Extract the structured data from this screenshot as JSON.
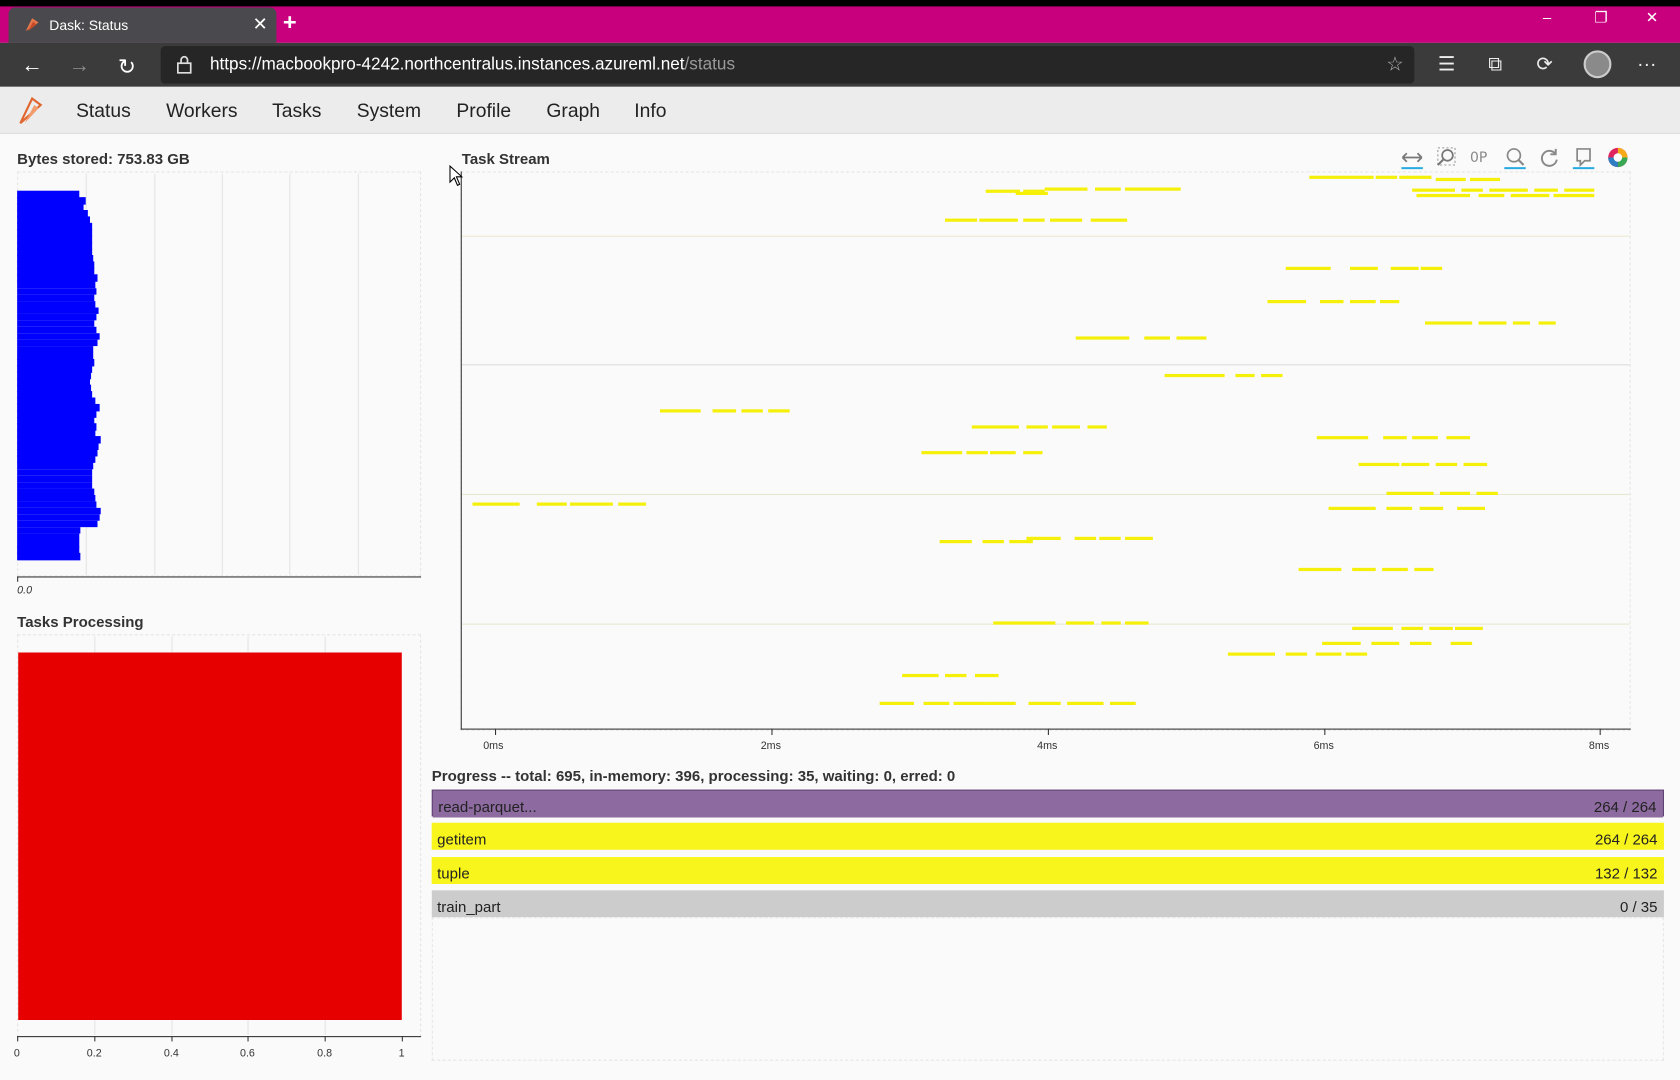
{
  "browser": {
    "tab_title": "Dask: Status",
    "tab_close": "✕",
    "new_tab": "+",
    "url_host": "https://macbookpro-4242.northcentralus.instances.azureml.net",
    "url_path": "/status",
    "window_controls": {
      "minimize": "–",
      "restore": "❐",
      "close": "✕"
    },
    "icons": {
      "back": "←",
      "forward": "→",
      "refresh": "↻",
      "favorite": "☆",
      "favorites_list": "☰",
      "collections": "⧉",
      "profile_sync": "⟳",
      "more": "···"
    }
  },
  "nav": {
    "items": [
      "Status",
      "Workers",
      "Tasks",
      "System",
      "Profile",
      "Graph",
      "Info"
    ]
  },
  "bytes_stored": {
    "title": "Bytes stored: 753.83 GB",
    "tick_label": "0.0",
    "bar_color": "#0000ff"
  },
  "tasks_processing": {
    "title": "Tasks Processing",
    "ticks": [
      "0",
      "0.2",
      "0.4",
      "0.6",
      "0.8",
      "1"
    ],
    "bar_color": "#e60000"
  },
  "task_stream": {
    "title": "Task Stream",
    "ticks": [
      "0ms",
      "2ms",
      "4ms",
      "6ms",
      "8ms"
    ],
    "task_color": "#f5f00a"
  },
  "progress": {
    "title": "Progress -- total: 695, in-memory: 396, processing: 35, waiting: 0, erred: 0",
    "rows": [
      {
        "name": "read-parquet...",
        "count": "264 / 264",
        "fraction": 1.0,
        "color": "#8d6aa0"
      },
      {
        "name": "getitem",
        "count": "264 / 264",
        "fraction": 1.0,
        "color": "#f8f51d"
      },
      {
        "name": "tuple",
        "count": "132 / 132",
        "fraction": 1.0,
        "color": "#f8f51d"
      },
      {
        "name": "train_part",
        "count": "0 / 35",
        "fraction": 0.0,
        "color": "#cccccc"
      }
    ]
  }
}
